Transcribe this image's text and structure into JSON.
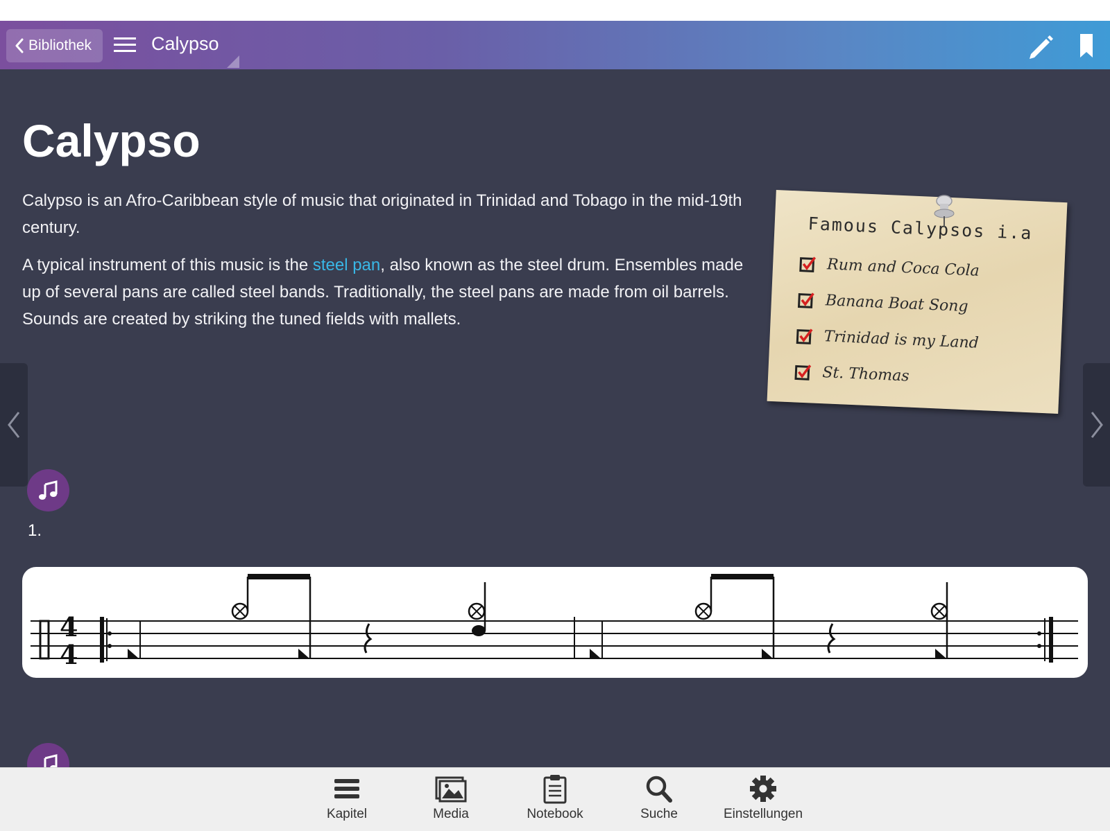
{
  "header": {
    "back_label": "Bibliothek",
    "title": "Calypso"
  },
  "article": {
    "title": "Calypso",
    "para1": "Calypso is an Afro-Caribbean style of music that originated in Trinidad and Tobago in the mid-19th century.",
    "para2_before": "A typical instrument of this music is the ",
    "para2_link": "steel pan",
    "para2_after": ", also known as the steel drum. Ensembles made up of several pans are called steel bands. Traditionally, the steel pans are made from oil barrels. Sounds are created by striking the tuned fields with mallets."
  },
  "note": {
    "title": "Famous Calypsos i.a",
    "items": [
      "Rum and Coca Cola",
      "Banana Boat Song",
      "Trinidad is my Land",
      "St. Thomas"
    ]
  },
  "exercise": {
    "number": "1."
  },
  "tabs": [
    {
      "label": "Kapitel",
      "icon": "list-icon"
    },
    {
      "label": "Media",
      "icon": "images-icon"
    },
    {
      "label": "Notebook",
      "icon": "clipboard-icon"
    },
    {
      "label": "Suche",
      "icon": "search-icon"
    },
    {
      "label": "Einstellungen",
      "icon": "gear-icon"
    }
  ],
  "colors": {
    "content_bg": "#3a3d4f",
    "link": "#39b7e6",
    "music_button": "#6e3a87"
  }
}
